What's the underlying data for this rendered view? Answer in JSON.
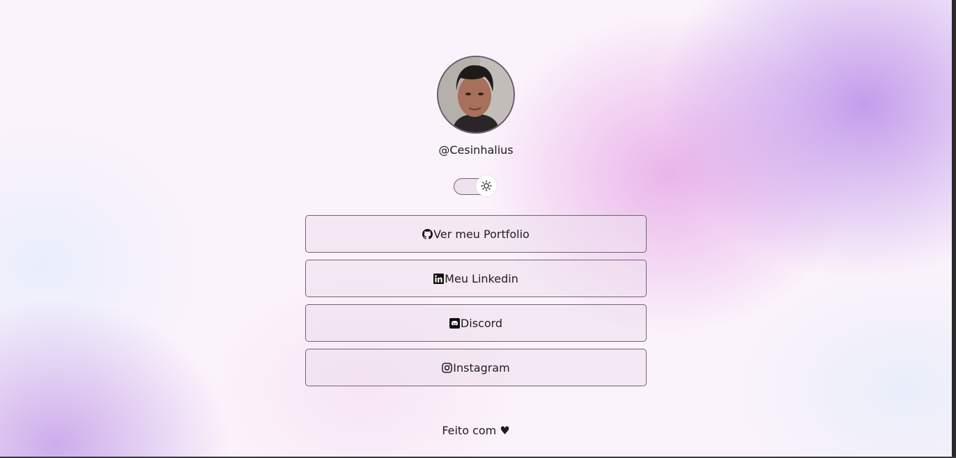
{
  "profile": {
    "username": "@Cesinhalius",
    "avatar_alt": "profile-photo"
  },
  "theme_toggle": {
    "state": "light",
    "icon": "sun-icon"
  },
  "links": [
    {
      "label": "Ver meu Portfolio",
      "icon": "github-icon"
    },
    {
      "label": "Meu Linkedin",
      "icon": "linkedin-icon"
    },
    {
      "label": "Discord",
      "icon": "discord-icon"
    },
    {
      "label": "Instagram",
      "icon": "instagram-icon"
    }
  ],
  "footer": {
    "text": "Feito com ♥"
  },
  "colors": {
    "accent_purple": "#ba8ee8",
    "accent_pink": "#e4a0e4",
    "border": "#6e6470",
    "text": "#1e1e1e"
  }
}
